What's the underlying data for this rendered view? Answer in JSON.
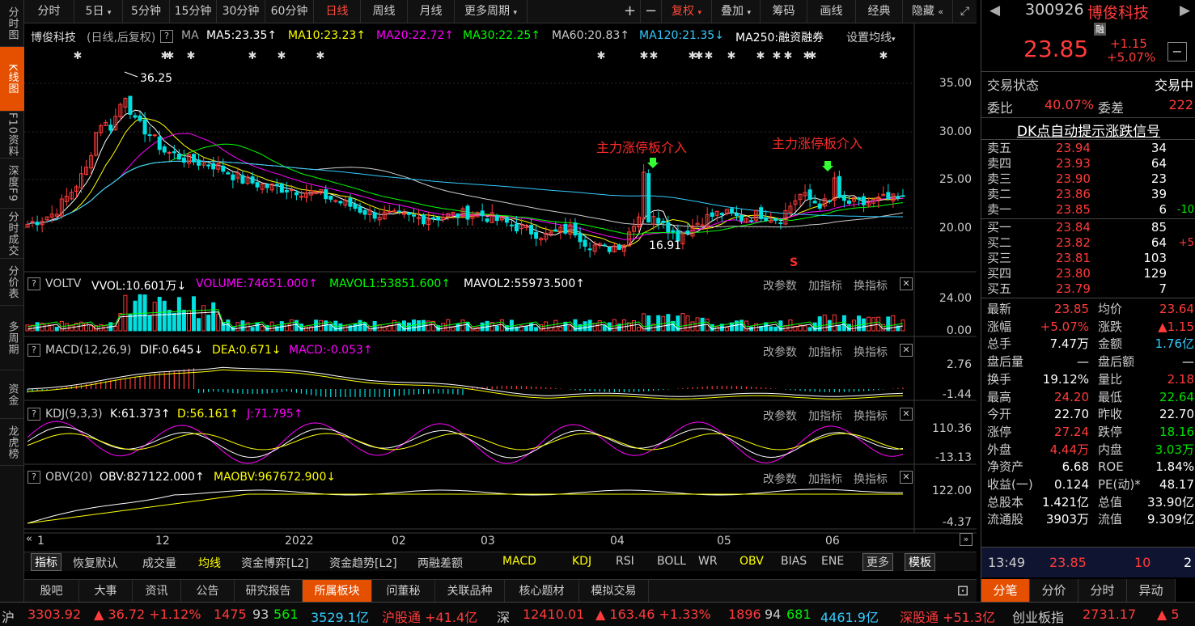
{
  "colors": {
    "up": "#ff3b3b",
    "down": "#00e0e0",
    "ma5": "#ffffff",
    "ma10": "#ffff00",
    "ma20": "#ff00ff",
    "ma30": "#00ff00",
    "ma60": "#cccccc",
    "ma120": "#33ccff",
    "orange": "#e55000"
  },
  "left_nav": [
    "分时图",
    "K线图",
    "F10资料",
    "深度F9",
    "分时成交",
    "分价表",
    "多周期",
    "资金",
    "龙虎榜"
  ],
  "left_nav_active": 1,
  "toolbar": {
    "items": [
      "分时",
      "5日",
      "5分钟",
      "15分钟",
      "30分钟",
      "60分钟",
      "日线",
      "周线",
      "月线",
      "更多周期"
    ],
    "active": "日线",
    "plus": "+",
    "minus": "−",
    "fuquan": "复权",
    "overlay": "叠加",
    "chouma": "筹码",
    "huaxian": "画线",
    "jingdian": "经典",
    "hide": "隐藏"
  },
  "main_header": {
    "name": "博俊科技",
    "mode": "(日线,后复权)",
    "ma": "MA",
    "ma5": "MA5:23.35",
    "ma10": "MA10:23.23",
    "ma20": "MA20:22.72",
    "ma30": "MA30:22.25",
    "ma60": "MA60:20.83",
    "ma120": "MA120:21.35",
    "ma250": "MA250:融资融券",
    "settings": "设置均线"
  },
  "annotations": {
    "high": "36.25",
    "low": "16.91",
    "signal1": "主力涨停板介入",
    "signal2": "主力涨停板介入",
    "s_mark": "S"
  },
  "price_axis": [
    "35.00",
    "30.00",
    "25.00",
    "20.00"
  ],
  "volume_panel": {
    "name": "VOLTV",
    "vvol": "VVOL:10.601万",
    "volume": "VOLUME:74651.000",
    "mavol1": "MAVOL1:53851.600",
    "mavol2": "MAVOL2:55973.500",
    "axis": [
      "24.00",
      "0.00"
    ]
  },
  "macd_panel": {
    "name": "MACD(12,26,9)",
    "dif": "DIF:0.645",
    "dea": "DEA:0.671",
    "macd": "MACD:-0.053",
    "axis": [
      "2.76",
      "-1.44"
    ]
  },
  "kdj_panel": {
    "name": "KDJ(9,3,3)",
    "k": "K:61.373",
    "d": "D:56.161",
    "j": "J:71.795",
    "axis": [
      "110.36",
      "-13.13"
    ]
  },
  "obv_panel": {
    "name": "OBV(20)",
    "obv": "OBV:827122.000",
    "maobv": "MAOBV:967672.900",
    "axis": [
      "122.00",
      "-4.37"
    ]
  },
  "panel_actions": {
    "edit": "改参数",
    "add": "加指标",
    "swap": "换指标",
    "close": "✕"
  },
  "x_axis": [
    "1",
    "12",
    "2022",
    "02",
    "03",
    "04",
    "05",
    "06"
  ],
  "indicator_bar": [
    "指标",
    "恢复默认",
    "成交量",
    "均线",
    "资金博弈[L2]",
    "资金趋势[L2]",
    "两融差额",
    "MACD",
    "KDJ",
    "RSI",
    "BOLL",
    "WR",
    "OBV",
    "BIAS",
    "ENE",
    "更多",
    "模板"
  ],
  "bottom_tabs": [
    "股吧",
    "大事",
    "资讯",
    "公告",
    "研究报告",
    "所属板块",
    "问董秘",
    "关联品种",
    "核心题材",
    "模拟交易"
  ],
  "bottom_tabs_active": "所属板块",
  "stock": {
    "code": "300926",
    "name": "博俊科技",
    "tag": "融",
    "price": "23.85",
    "change": "+1.15",
    "pct": "+5.07%"
  },
  "trade": {
    "status_label": "交易状态",
    "status": "交易中",
    "weibi_label": "委比",
    "weibi": "40.07%",
    "weicha_label": "委差",
    "weicha": "222"
  },
  "dk_title": "DK点自动提示涨跌信号",
  "sell": [
    {
      "label": "卖五",
      "price": "23.94",
      "vol": "34",
      "chg": ""
    },
    {
      "label": "卖四",
      "price": "23.93",
      "vol": "64",
      "chg": ""
    },
    {
      "label": "卖三",
      "price": "23.90",
      "vol": "23",
      "chg": ""
    },
    {
      "label": "卖二",
      "price": "23.86",
      "vol": "39",
      "chg": ""
    },
    {
      "label": "卖一",
      "price": "23.85",
      "vol": "6",
      "chg": "-10"
    }
  ],
  "buy": [
    {
      "label": "买一",
      "price": "23.84",
      "vol": "85",
      "chg": ""
    },
    {
      "label": "买二",
      "price": "23.82",
      "vol": "64",
      "chg": "+5"
    },
    {
      "label": "买三",
      "price": "23.81",
      "vol": "103",
      "chg": ""
    },
    {
      "label": "买四",
      "price": "23.80",
      "vol": "129",
      "chg": ""
    },
    {
      "label": "买五",
      "price": "23.79",
      "vol": "7",
      "chg": ""
    }
  ],
  "stats": [
    {
      "l1": "最新",
      "v1": "23.85",
      "l2": "均价",
      "v2": "23.64",
      "c1": "#ff3b3b",
      "c2": "#ff3b3b"
    },
    {
      "l1": "涨幅",
      "v1": "+5.07%",
      "l2": "涨跌",
      "v2": "▲1.15",
      "c1": "#ff3b3b",
      "c2": "#ff3b3b"
    },
    {
      "l1": "总手",
      "v1": "7.47万",
      "l2": "金额",
      "v2": "1.76亿",
      "c1": "#ffffff",
      "c2": "#33ccff"
    },
    {
      "l1": "盘后量",
      "v1": "—",
      "l2": "盘后额",
      "v2": "—",
      "c1": "#ffffff",
      "c2": "#ffffff"
    },
    {
      "l1": "换手",
      "v1": "19.12%",
      "l2": "量比",
      "v2": "2.18",
      "c1": "#ffffff",
      "c2": "#ff3b3b"
    },
    {
      "l1": "最高",
      "v1": "24.20",
      "l2": "最低",
      "v2": "22.64",
      "c1": "#ff3b3b",
      "c2": "#00e000"
    },
    {
      "l1": "今开",
      "v1": "22.70",
      "l2": "昨收",
      "v2": "22.70",
      "c1": "#ffffff",
      "c2": "#ffffff"
    },
    {
      "l1": "涨停",
      "v1": "27.24",
      "l2": "跌停",
      "v2": "18.16",
      "c1": "#ff3b3b",
      "c2": "#00e000"
    },
    {
      "l1": "外盘",
      "v1": "4.44万",
      "l2": "内盘",
      "v2": "3.03万",
      "c1": "#ff3b3b",
      "c2": "#00e000"
    },
    {
      "l1": "净资产",
      "v1": "6.68",
      "l2": "ROE",
      "v2": "1.84%",
      "c1": "#ffffff",
      "c2": "#ffffff"
    },
    {
      "l1": "收益(一)",
      "v1": "0.124",
      "l2": "PE(动)*",
      "v2": "48.17",
      "c1": "#ffffff",
      "c2": "#ffffff"
    },
    {
      "l1": "总股本",
      "v1": "1.421亿",
      "l2": "总值",
      "v2": "33.90亿",
      "c1": "#ffffff",
      "c2": "#ffffff"
    },
    {
      "l1": "流通股",
      "v1": "3903万",
      "l2": "流值",
      "v2": "9.309亿",
      "c1": "#ffffff",
      "c2": "#ffffff"
    }
  ],
  "tick": {
    "time": "13:49",
    "price": "23.85",
    "vol": "10",
    "count": "2"
  },
  "right_tabs": [
    "分笔",
    "分价",
    "分时",
    "异动"
  ],
  "ticker": {
    "sh_label": "沪",
    "sh_val": "3303.92",
    "sh_chg": "▲ 36.72 +1.12%",
    "sh_up": "1475",
    "sh_flat": "93",
    "sh_down": "561",
    "sh_amt": "3529.1亿",
    "hgt": "沪股通 +41.4亿",
    "sz_label": "深",
    "sz_val": "12410.01",
    "sz_chg": "▲ 163.46 +1.33%",
    "sz_up": "1896",
    "sz_flat": "94",
    "sz_down": "681",
    "sz_amt": "4461.9亿",
    "sgt": "深股通 +51.3亿",
    "cyb_label": "创业板指",
    "cyb_val": "2731.17",
    "cyb_chg": "▲ 5"
  }
}
